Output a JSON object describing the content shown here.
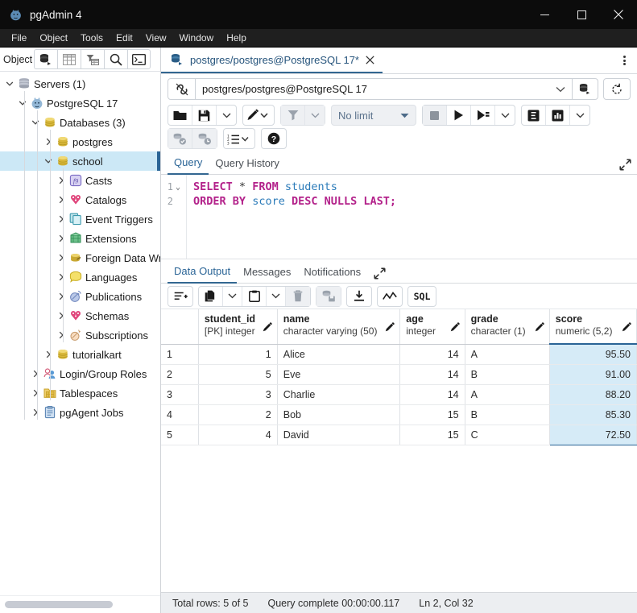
{
  "window": {
    "app_icon": "postgres-elephant-icon",
    "title": "pgAdmin 4",
    "minimize": "minimize-icon",
    "maximize": "maximize-icon",
    "close": "close-icon"
  },
  "menubar": {
    "items": [
      "File",
      "Object",
      "Tools",
      "Edit",
      "View",
      "Window",
      "Help"
    ]
  },
  "object_explorer": {
    "label": "Object",
    "toolbar_icons": [
      "server-icon",
      "table-icon",
      "filter-table-icon",
      "search-icon",
      "terminal-icon"
    ],
    "tree": [
      {
        "label": "Servers (1)",
        "indent": 0,
        "chevron": "down",
        "icon": "servers-icon",
        "selected": false
      },
      {
        "label": "PostgreSQL 17",
        "indent": 1,
        "chevron": "down",
        "icon": "postgres-icon",
        "selected": false
      },
      {
        "label": "Databases (3)",
        "indent": 2,
        "chevron": "down",
        "icon": "database-icon",
        "selected": false
      },
      {
        "label": "postgres",
        "indent": 3,
        "chevron": "right",
        "icon": "database-icon",
        "selected": false
      },
      {
        "label": "school",
        "indent": 3,
        "chevron": "down",
        "icon": "database-icon",
        "selected": true
      },
      {
        "label": "Casts",
        "indent": 4,
        "chevron": "right",
        "icon": "casts-icon",
        "selected": false
      },
      {
        "label": "Catalogs",
        "indent": 4,
        "chevron": "right",
        "icon": "catalogs-icon",
        "selected": false
      },
      {
        "label": "Event Triggers",
        "indent": 4,
        "chevron": "right",
        "icon": "event-triggers-icon",
        "selected": false
      },
      {
        "label": "Extensions",
        "indent": 4,
        "chevron": "right",
        "icon": "extensions-icon",
        "selected": false
      },
      {
        "label": "Foreign Data Wrappers",
        "indent": 4,
        "chevron": "right",
        "icon": "foreign-data-wrappers-icon",
        "selected": false
      },
      {
        "label": "Languages",
        "indent": 4,
        "chevron": "right",
        "icon": "languages-icon",
        "selected": false
      },
      {
        "label": "Publications",
        "indent": 4,
        "chevron": "right",
        "icon": "publications-icon",
        "selected": false
      },
      {
        "label": "Schemas",
        "indent": 4,
        "chevron": "right",
        "icon": "schemas-icon",
        "selected": false
      },
      {
        "label": "Subscriptions",
        "indent": 4,
        "chevron": "right",
        "icon": "subscriptions-icon",
        "selected": false
      },
      {
        "label": "tutorialkart",
        "indent": 3,
        "chevron": "right",
        "icon": "database-icon",
        "selected": false
      },
      {
        "label": "Login/Group Roles",
        "indent": 2,
        "chevron": "right",
        "icon": "roles-icon",
        "selected": false
      },
      {
        "label": "Tablespaces",
        "indent": 2,
        "chevron": "right",
        "icon": "tablespaces-icon",
        "selected": false
      },
      {
        "label": "pgAgent Jobs",
        "indent": 2,
        "chevron": "right",
        "icon": "pgagent-jobs-icon",
        "selected": false
      }
    ]
  },
  "query_tool": {
    "tab": {
      "icon": "query-tool-icon",
      "title": "postgres/postgres@PostgreSQL 17*",
      "close": "close-icon"
    },
    "kebab_menu": "more-options-icon",
    "connection": {
      "icon": "connection-icon",
      "value": "postgres/postgres@PostgreSQL 17",
      "caret": "chevron-down-icon",
      "manage_icon": "manage-connections-icon",
      "refresh_icon": "reset-icon"
    },
    "toolbar": {
      "row1": [
        {
          "name": "open-file-button",
          "icon": "folder-icon"
        },
        {
          "name": "save-file-button",
          "icon": "save-icon"
        },
        {
          "name": "save-file-dropdown",
          "icon": "chevron-down-icon"
        },
        {
          "name": "edit-button",
          "icon": "pencil-icon"
        },
        {
          "name": "edit-dropdown",
          "icon": "chevron-down-icon"
        },
        {
          "name": "filter-button",
          "icon": "filter-icon"
        },
        {
          "name": "filter-dropdown",
          "icon": "chevron-down-icon"
        },
        {
          "name": "row-limit-select",
          "label": "No limit",
          "icon": "caret-down-icon"
        },
        {
          "name": "stop-button",
          "icon": "stop-icon"
        },
        {
          "name": "execute-button",
          "icon": "play-icon"
        },
        {
          "name": "execute-script-button",
          "icon": "play-script-icon"
        },
        {
          "name": "execute-dropdown",
          "icon": "chevron-down-icon"
        },
        {
          "name": "explain-button",
          "icon": "explain-icon"
        },
        {
          "name": "explain-analyze-button",
          "icon": "explain-analyze-icon"
        },
        {
          "name": "explain-dropdown",
          "icon": "chevron-down-icon"
        }
      ],
      "row2": [
        {
          "name": "commit-button",
          "icon": "commit-icon"
        },
        {
          "name": "rollback-button",
          "icon": "rollback-icon"
        },
        {
          "name": "macros-button",
          "icon": "macros-icon"
        },
        {
          "name": "help-button",
          "icon": "help-icon"
        }
      ]
    },
    "editor_tabs": [
      {
        "label": "Query",
        "active": true
      },
      {
        "label": "Query History",
        "active": false
      }
    ],
    "expand_icon": "expand-icon",
    "sql_lines": [
      {
        "number": "1",
        "fold": "chevron-down-icon",
        "tokens": [
          {
            "t": "SELECT",
            "c": "kw"
          },
          {
            "t": " ",
            "c": "op"
          },
          {
            "t": "*",
            "c": "op"
          },
          {
            "t": " ",
            "c": "op"
          },
          {
            "t": "FROM",
            "c": "kw"
          },
          {
            "t": " ",
            "c": "op"
          },
          {
            "t": "students",
            "c": "id"
          }
        ]
      },
      {
        "number": "2",
        "fold": "",
        "tokens": [
          {
            "t": "ORDER",
            "c": "kw"
          },
          {
            "t": " ",
            "c": "op"
          },
          {
            "t": "BY",
            "c": "kw"
          },
          {
            "t": " ",
            "c": "op"
          },
          {
            "t": "score",
            "c": "id"
          },
          {
            "t": " ",
            "c": "op"
          },
          {
            "t": "DESC",
            "c": "kw"
          },
          {
            "t": " ",
            "c": "op"
          },
          {
            "t": "NULLS",
            "c": "kw"
          },
          {
            "t": " ",
            "c": "op"
          },
          {
            "t": "LAST",
            "c": "kw"
          },
          {
            "t": ";",
            "c": "pn"
          }
        ]
      }
    ]
  },
  "results": {
    "tabs": [
      {
        "label": "Data Output",
        "active": true
      },
      {
        "label": "Messages",
        "active": false
      },
      {
        "label": "Notifications",
        "active": false
      }
    ],
    "expand_icon": "expand-icon",
    "toolbar": [
      {
        "name": "add-row-button",
        "icon": "add-row-icon"
      },
      {
        "name": "copy-button",
        "icon": "copy-icon"
      },
      {
        "name": "copy-dropdown",
        "icon": "chevron-down-icon"
      },
      {
        "name": "paste-button",
        "icon": "paste-icon"
      },
      {
        "name": "paste-dropdown",
        "icon": "chevron-down-icon"
      },
      {
        "name": "delete-row-button",
        "icon": "trash-icon"
      },
      {
        "name": "save-data-changes-button",
        "icon": "save-data-icon"
      },
      {
        "name": "download-csv-button",
        "icon": "download-icon"
      },
      {
        "name": "graph-visualiser-button",
        "icon": "graph-icon"
      },
      {
        "name": "query-sql-button",
        "icon": "sql-icon"
      }
    ],
    "columns": [
      {
        "name": "student_id",
        "type": "[PK] integer",
        "align": "num"
      },
      {
        "name": "name",
        "type": "character varying (50)",
        "align": "txt"
      },
      {
        "name": "age",
        "type": "integer",
        "align": "num"
      },
      {
        "name": "grade",
        "type": "character (1)",
        "align": "txt"
      },
      {
        "name": "score",
        "type": "numeric (5,2)",
        "align": "sc"
      }
    ],
    "edit_icon": "pencil-icon",
    "rows": [
      {
        "n": "1",
        "cells": [
          "1",
          "Alice",
          "14",
          "A",
          "95.50"
        ]
      },
      {
        "n": "2",
        "cells": [
          "5",
          "Eve",
          "14",
          "B",
          "91.00"
        ]
      },
      {
        "n": "3",
        "cells": [
          "3",
          "Charlie",
          "14",
          "A",
          "88.20"
        ]
      },
      {
        "n": "4",
        "cells": [
          "2",
          "Bob",
          "15",
          "B",
          "85.30"
        ]
      },
      {
        "n": "5",
        "cells": [
          "4",
          "David",
          "15",
          "C",
          "72.50"
        ]
      }
    ]
  },
  "statusbar": {
    "total_rows": "Total rows: 5 of 5",
    "query_status": "Query complete 00:00:00.117",
    "cursor_position": "Ln 2, Col 32"
  },
  "colors": {
    "accent": "#336791",
    "selection": "#cce8f6",
    "selected_cell": "#d6ebf7",
    "titlebar": "#0c0c0c",
    "menubar": "#1f1f1f",
    "keyword": "#b3218a",
    "identifier": "#2b7bb9"
  }
}
